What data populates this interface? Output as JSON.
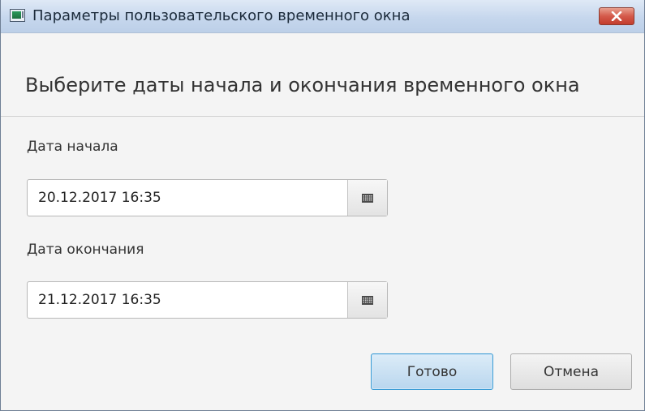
{
  "window": {
    "title": "Параметры пользовательского временного окна",
    "close_icon": "close-x-icon"
  },
  "header": {
    "text": "Выберите даты начала и окончания временного окна"
  },
  "start": {
    "label": "Дата начала",
    "value": "20.12.2017 16:35",
    "calendar_icon": "calendar-icon"
  },
  "end": {
    "label": "Дата окончания",
    "value": "21.12.2017 16:35",
    "calendar_icon": "calendar-icon"
  },
  "buttons": {
    "ok_label": "Готово",
    "cancel_label": "Отмена"
  },
  "colors": {
    "titlebar": "#c6d7ed",
    "close_button": "#d4594a",
    "default_button_border": "#3a9bd4"
  }
}
